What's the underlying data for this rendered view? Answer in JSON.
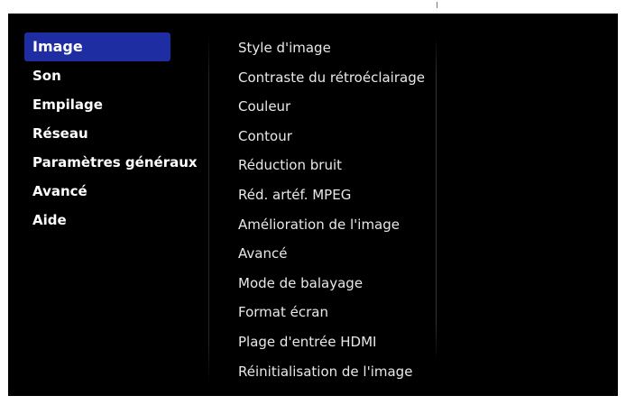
{
  "sidebar": {
    "items": [
      {
        "label": "Image"
      },
      {
        "label": "Son"
      },
      {
        "label": "Empilage"
      },
      {
        "label": "Réseau"
      },
      {
        "label": "Paramètres généraux"
      },
      {
        "label": "Avancé"
      },
      {
        "label": "Aide"
      }
    ]
  },
  "submenu": {
    "items": [
      {
        "label": "Style d'image"
      },
      {
        "label": "Contraste du rétroéclairage"
      },
      {
        "label": "Couleur"
      },
      {
        "label": "Contour"
      },
      {
        "label": "Réduction bruit"
      },
      {
        "label": "Réd. artéf. MPEG"
      },
      {
        "label": "Amélioration de l'image"
      },
      {
        "label": "Avancé"
      },
      {
        "label": "Mode de balayage"
      },
      {
        "label": "Format écran"
      },
      {
        "label": "Plage d'entrée HDMI"
      },
      {
        "label": "Réinitialisation de l'image"
      }
    ]
  },
  "colors": {
    "background": "#000000",
    "selection": "#1f2da3",
    "text": "#ffffff"
  }
}
